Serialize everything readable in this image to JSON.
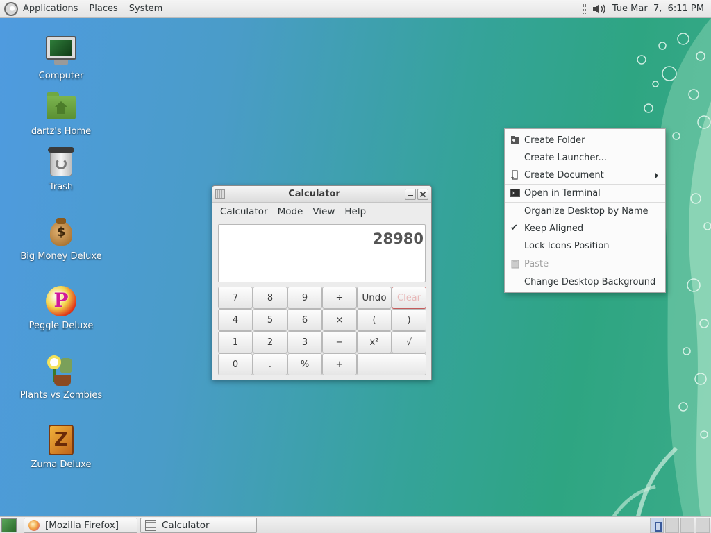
{
  "top_panel": {
    "menus": [
      "Applications",
      "Places",
      "System"
    ],
    "clock": "Tue Mar  7,  6:11 PM"
  },
  "desktop_icons": [
    {
      "label": "Computer",
      "icon": "computer-icon"
    },
    {
      "label": "dartz's Home",
      "icon": "home-folder-icon"
    },
    {
      "label": "Trash",
      "icon": "trash-icon"
    },
    {
      "label": "Big Money Deluxe",
      "icon": "money-bag-icon"
    },
    {
      "label": "Peggle Deluxe",
      "icon": "peggle-icon"
    },
    {
      "label": "Plants vs Zombies",
      "icon": "plants-vs-zombies-icon"
    },
    {
      "label": "Zuma Deluxe",
      "icon": "zuma-icon"
    }
  ],
  "calculator": {
    "title": "Calculator",
    "menus": [
      "Calculator",
      "Mode",
      "View",
      "Help"
    ],
    "display": "28980",
    "keys": [
      "7",
      "8",
      "9",
      "÷",
      "Undo",
      "Clear",
      "4",
      "5",
      "6",
      "×",
      "(",
      ")",
      "1",
      "2",
      "3",
      "−",
      "x²",
      "√",
      "0",
      ".",
      "%",
      "+",
      ""
    ]
  },
  "context_menu": {
    "items": [
      {
        "label": "Create Folder",
        "icon": "folder-plus-icon"
      },
      {
        "label": "Create Launcher...",
        "icon": ""
      },
      {
        "label": "Create Document",
        "icon": "document-icon",
        "submenu": true
      },
      {
        "label": "Open in Terminal",
        "icon": "terminal-icon"
      },
      {
        "label": "Organize Desktop by Name",
        "icon": ""
      },
      {
        "label": "Keep Aligned",
        "icon": "",
        "checked": true
      },
      {
        "label": "Lock Icons Position",
        "icon": ""
      },
      {
        "label": "Paste",
        "icon": "paste-icon",
        "disabled": true
      },
      {
        "label": "Change Desktop Background",
        "icon": ""
      }
    ]
  },
  "taskbar": {
    "tasks": [
      {
        "label": "[Mozilla Firefox]",
        "icon": "firefox-icon"
      },
      {
        "label": "Calculator",
        "icon": "calculator-icon"
      }
    ]
  }
}
